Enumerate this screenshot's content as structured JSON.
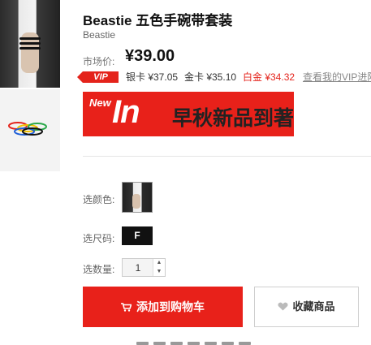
{
  "product": {
    "title": "Beastie 五色手碗带套装",
    "brand": "Beastie",
    "price_label": "市场价:",
    "price": "¥39.00"
  },
  "vip": {
    "badge": "VIP",
    "silver": "银卡 ¥37.05",
    "gold": "金卡 ¥35.10",
    "platinum": "白金 ¥34.32",
    "link": "查看我的VIP进阶"
  },
  "banner": {
    "new": "New",
    "in": "In",
    "text": "早秋新品到著"
  },
  "options": {
    "color_label": "选颜色:",
    "size_label": "选尺码:",
    "size_value": "F",
    "qty_label": "选数量:",
    "qty_value": "1"
  },
  "actions": {
    "cart": "添加到购物车",
    "fav": "收藏商品"
  },
  "colors": {
    "accent": "#e8211a",
    "vip_red": "#e4231b"
  }
}
